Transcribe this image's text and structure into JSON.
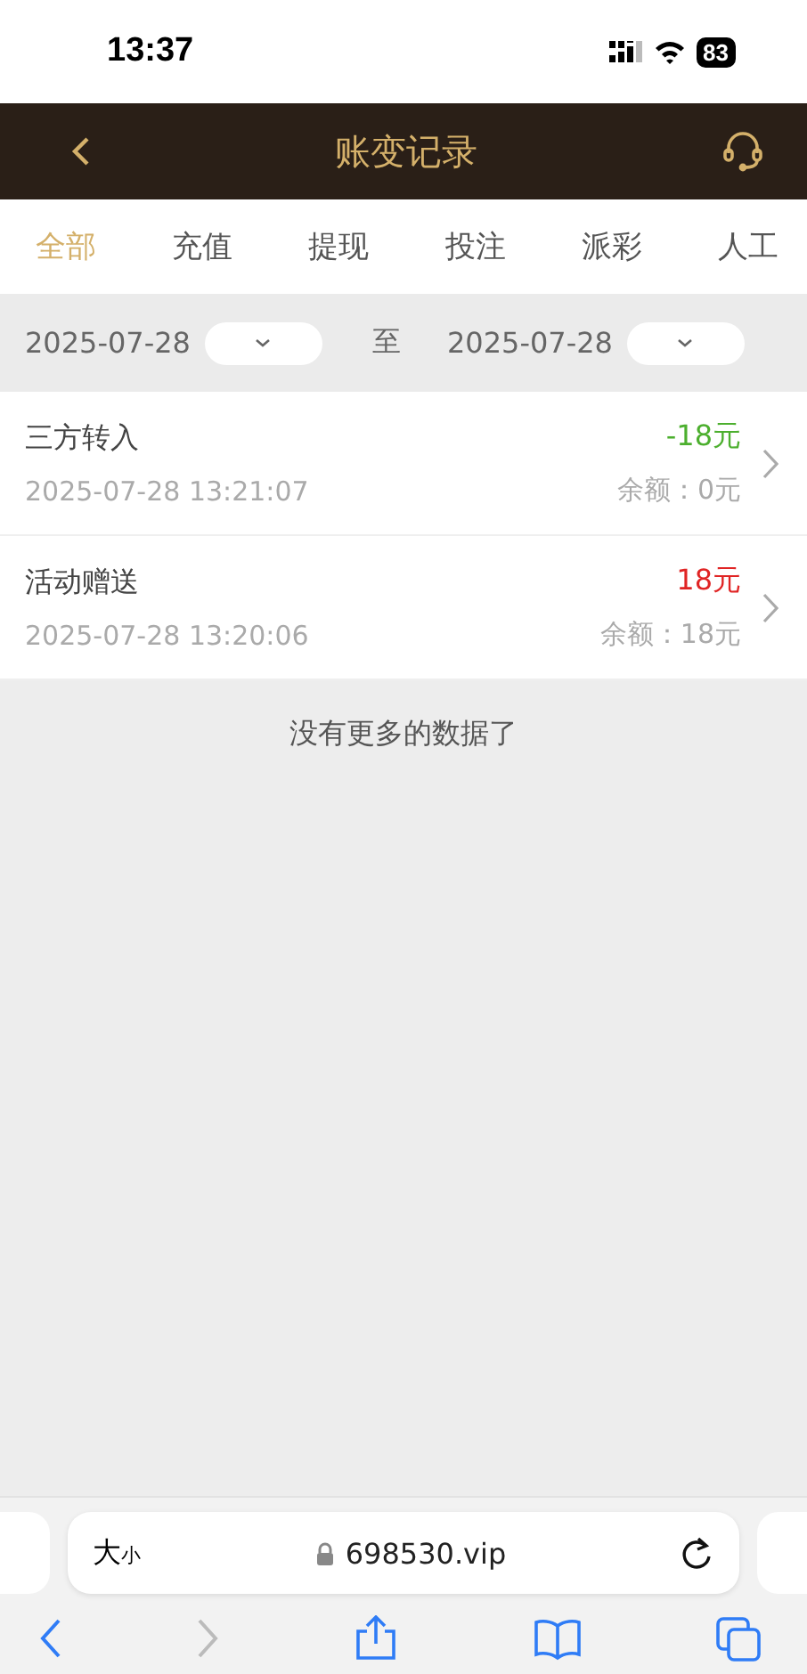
{
  "status_bar": {
    "time": "13:37",
    "battery": "83"
  },
  "header": {
    "title": "账变记录"
  },
  "tabs": [
    {
      "label": "全部",
      "selected": true
    },
    {
      "label": "充值",
      "selected": false
    },
    {
      "label": "提现",
      "selected": false
    },
    {
      "label": "投注",
      "selected": false
    },
    {
      "label": "派彩",
      "selected": false
    },
    {
      "label": "人工",
      "selected": false
    }
  ],
  "date_filter": {
    "start": "2025-07-28",
    "separator": "至",
    "end": "2025-07-28"
  },
  "records": [
    {
      "title": "三方转入",
      "time": "2025-07-28 13:21:07",
      "amount": "-18元",
      "color": "#4caf2e",
      "balance": "余额：0元"
    },
    {
      "title": "活动赠送",
      "time": "2025-07-28 13:20:06",
      "amount": "18元",
      "color": "#e02424",
      "balance": "余额：18元"
    }
  ],
  "end_note": "没有更多的数据了",
  "browser": {
    "text_size": "大小",
    "url": "698530.vip",
    "back_disabled": false,
    "forward_disabled": true
  }
}
